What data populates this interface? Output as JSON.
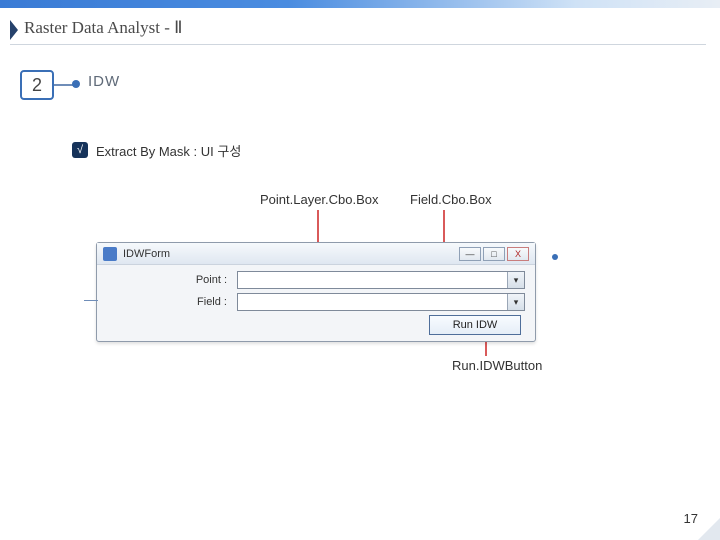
{
  "slide": {
    "title": "Raster Data Analyst - Ⅱ",
    "section_number": "2",
    "section_label": "IDW",
    "sub_bullet_mark": "√",
    "sub_bullet_text": "Extract By Mask : UI 구성",
    "page_number": "17"
  },
  "annotations": {
    "point_layer": "Point.Layer.Cbo.Box",
    "field": "Field.Cbo.Box",
    "run_button": "Run.IDWButton"
  },
  "idw_form": {
    "window_title": "IDWForm",
    "labels": {
      "point": "Point :",
      "field": "Field :"
    },
    "point_value": "",
    "field_value": "",
    "run_label": "Run IDW",
    "window_buttons": {
      "min": "—",
      "max": "□",
      "close": "X"
    }
  }
}
